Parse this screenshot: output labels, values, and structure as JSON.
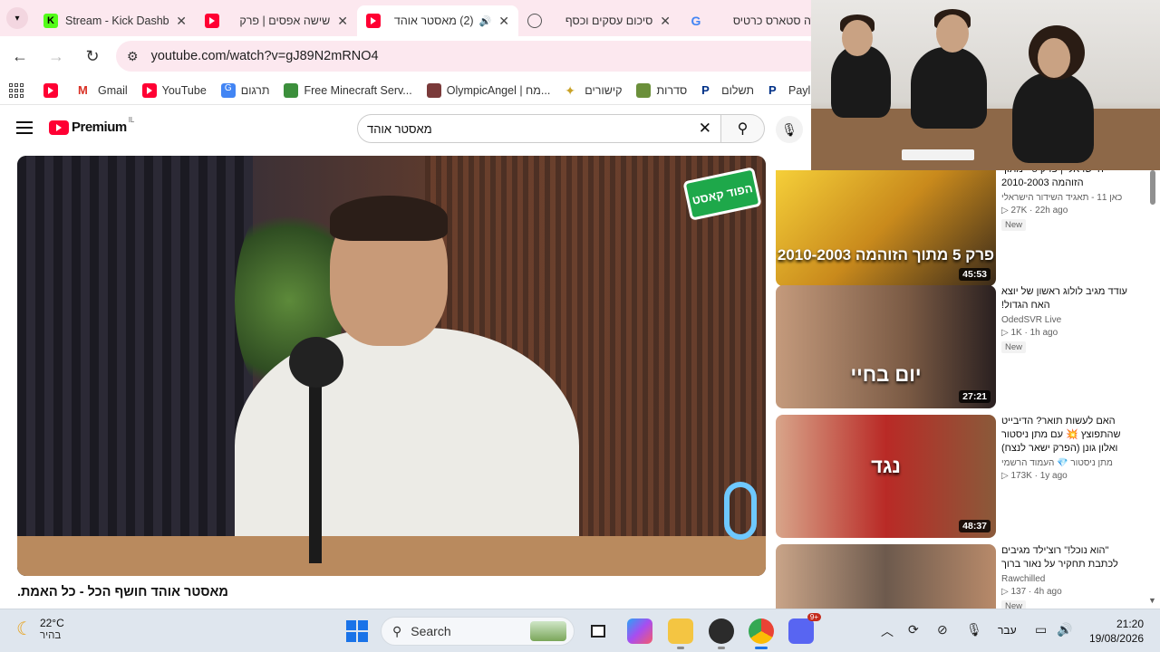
{
  "browser": {
    "tabs": [
      {
        "title": "Stream - Kick Dashb",
        "favicon": "kick-icon",
        "active": false
      },
      {
        "title": "שישה אפסים | פרק",
        "favicon": "youtube-icon",
        "active": false
      },
      {
        "title": "(2) מאסטר אוהד",
        "favicon": "youtube-icon",
        "active": true,
        "audio": true
      },
      {
        "title": "סיכום עסקים וכסף",
        "favicon": "chatgpt-icon",
        "active": false
      },
      {
        "title": "מנורה סטארס כרטיס",
        "favicon": "google-icon",
        "active": false
      }
    ],
    "url": "youtube.com/watch?v=gJ89N2mRNO4",
    "bookmarks": [
      {
        "label": "",
        "icon": "youtube-icon"
      },
      {
        "label": "Gmail",
        "icon": "gmail-icon"
      },
      {
        "label": "YouTube",
        "icon": "youtube-icon"
      },
      {
        "label": "תרגום",
        "icon": "translate-icon"
      },
      {
        "label": "Free Minecraft Serv...",
        "icon": "minecraft-icon"
      },
      {
        "label": "OlympicAngel | מח...",
        "icon": "avatar-icon"
      },
      {
        "label": "קישורים",
        "icon": "star-icon"
      },
      {
        "label": "סדרות",
        "icon": "tv-icon"
      },
      {
        "label": "תשלום",
        "icon": "paypal-icon"
      },
      {
        "label": "Payl",
        "icon": "paypal-icon"
      }
    ]
  },
  "youtube": {
    "logo_text": "Premium",
    "country_code": "IL",
    "search_query": "מאסטר אוהד",
    "video_title": "מאסטר אוהד חושף הכל - כל האמת.",
    "player_badge": "הפוד קאסט",
    "recommendations": [
      {
        "title": "היישראלי | פרק 5 - מתוך הזוהמה 2010-2003",
        "channel": "כאן 11 - תאגיד השידור הישראלי",
        "stats": "27K · 22h ago",
        "badge": "New",
        "duration": "45:53",
        "thumb_text": "פרק 5 מתוך הזוהמה 2010-2003",
        "thumb_color": "#d7b13a"
      },
      {
        "title": "עודד מגיב לולוג ראשון של יוצא האח הגדול!",
        "channel": "OdedSVR Live",
        "stats": "1K · 1h ago",
        "badge": "New",
        "duration": "27:21",
        "thumb_text": "יום בחיי",
        "thumb_color": "#7a5a44"
      },
      {
        "title": "האם לעשות תואר? הדיבייט שהתפוצץ 💥 עם מתן ניסטור ואלון גונן (הפרק ישאר לנצח)",
        "channel": "מתן ניסטור 💎 העמוד הרשמי",
        "stats": "173K · 1y ago",
        "badge": "",
        "duration": "48:37",
        "thumb_text": "נגד",
        "thumb_color": "#b92a26"
      },
      {
        "title": "\"הוא נוכל!\" רוצ'ילד מגיבים לכתבת תחקיר על נאור ברוך",
        "channel": "Rawchilled",
        "stats": "137 · 4h ago",
        "badge": "New",
        "duration": "",
        "thumb_text": "",
        "thumb_color": "#6d5a4d"
      }
    ]
  },
  "taskbar": {
    "weather_temp": "22°C",
    "weather_desc": "בהיר",
    "search_placeholder": "Search",
    "language": "עבר",
    "time": "21:20",
    "date": "19/08/2026",
    "discord_badge": "9+"
  }
}
